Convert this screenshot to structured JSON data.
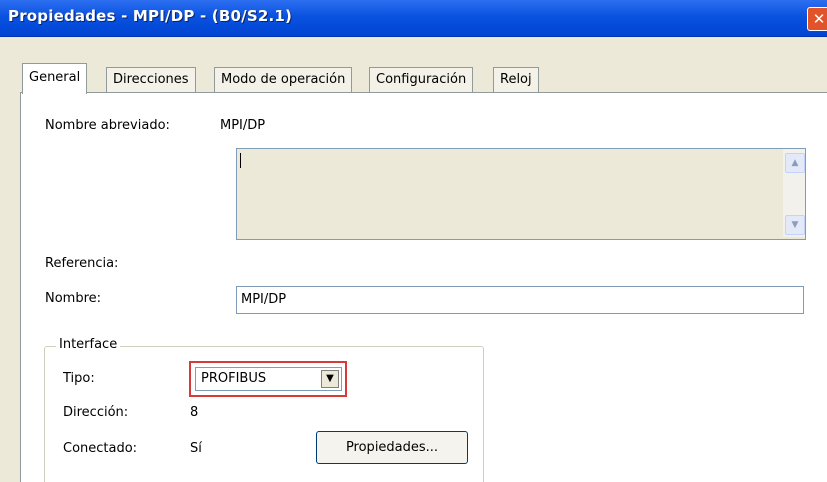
{
  "window": {
    "title": "Propiedades - MPI/DP - (B0/S2.1)",
    "close_glyph": "✕"
  },
  "tabs": [
    {
      "label": "General",
      "active": true
    },
    {
      "label": "Direcciones",
      "active": false
    },
    {
      "label": "Modo de operación",
      "active": false
    },
    {
      "label": "Configuración",
      "active": false
    },
    {
      "label": "Reloj",
      "active": false
    }
  ],
  "general": {
    "short_name_label": "Nombre abreviado:",
    "short_name_value": "MPI/DP",
    "comment_value": "",
    "scroll_up": "▲",
    "scroll_down": "▼",
    "reference_label": "Referencia:",
    "name_label": "Nombre:",
    "name_value": "MPI/DP"
  },
  "interface": {
    "legend": "Interface",
    "type_label": "Tipo:",
    "type_value": "PROFIBUS",
    "dropdown_glyph": "▼",
    "address_label": "Dirección:",
    "address_value": "8",
    "connected_label": "Conectado:",
    "connected_value": "Sí",
    "properties_button": "Propiedades..."
  },
  "colors": {
    "title_bar": "#0A52E0",
    "highlight_box": "#D83A3A",
    "dialog_bg": "#ECE9D8"
  }
}
